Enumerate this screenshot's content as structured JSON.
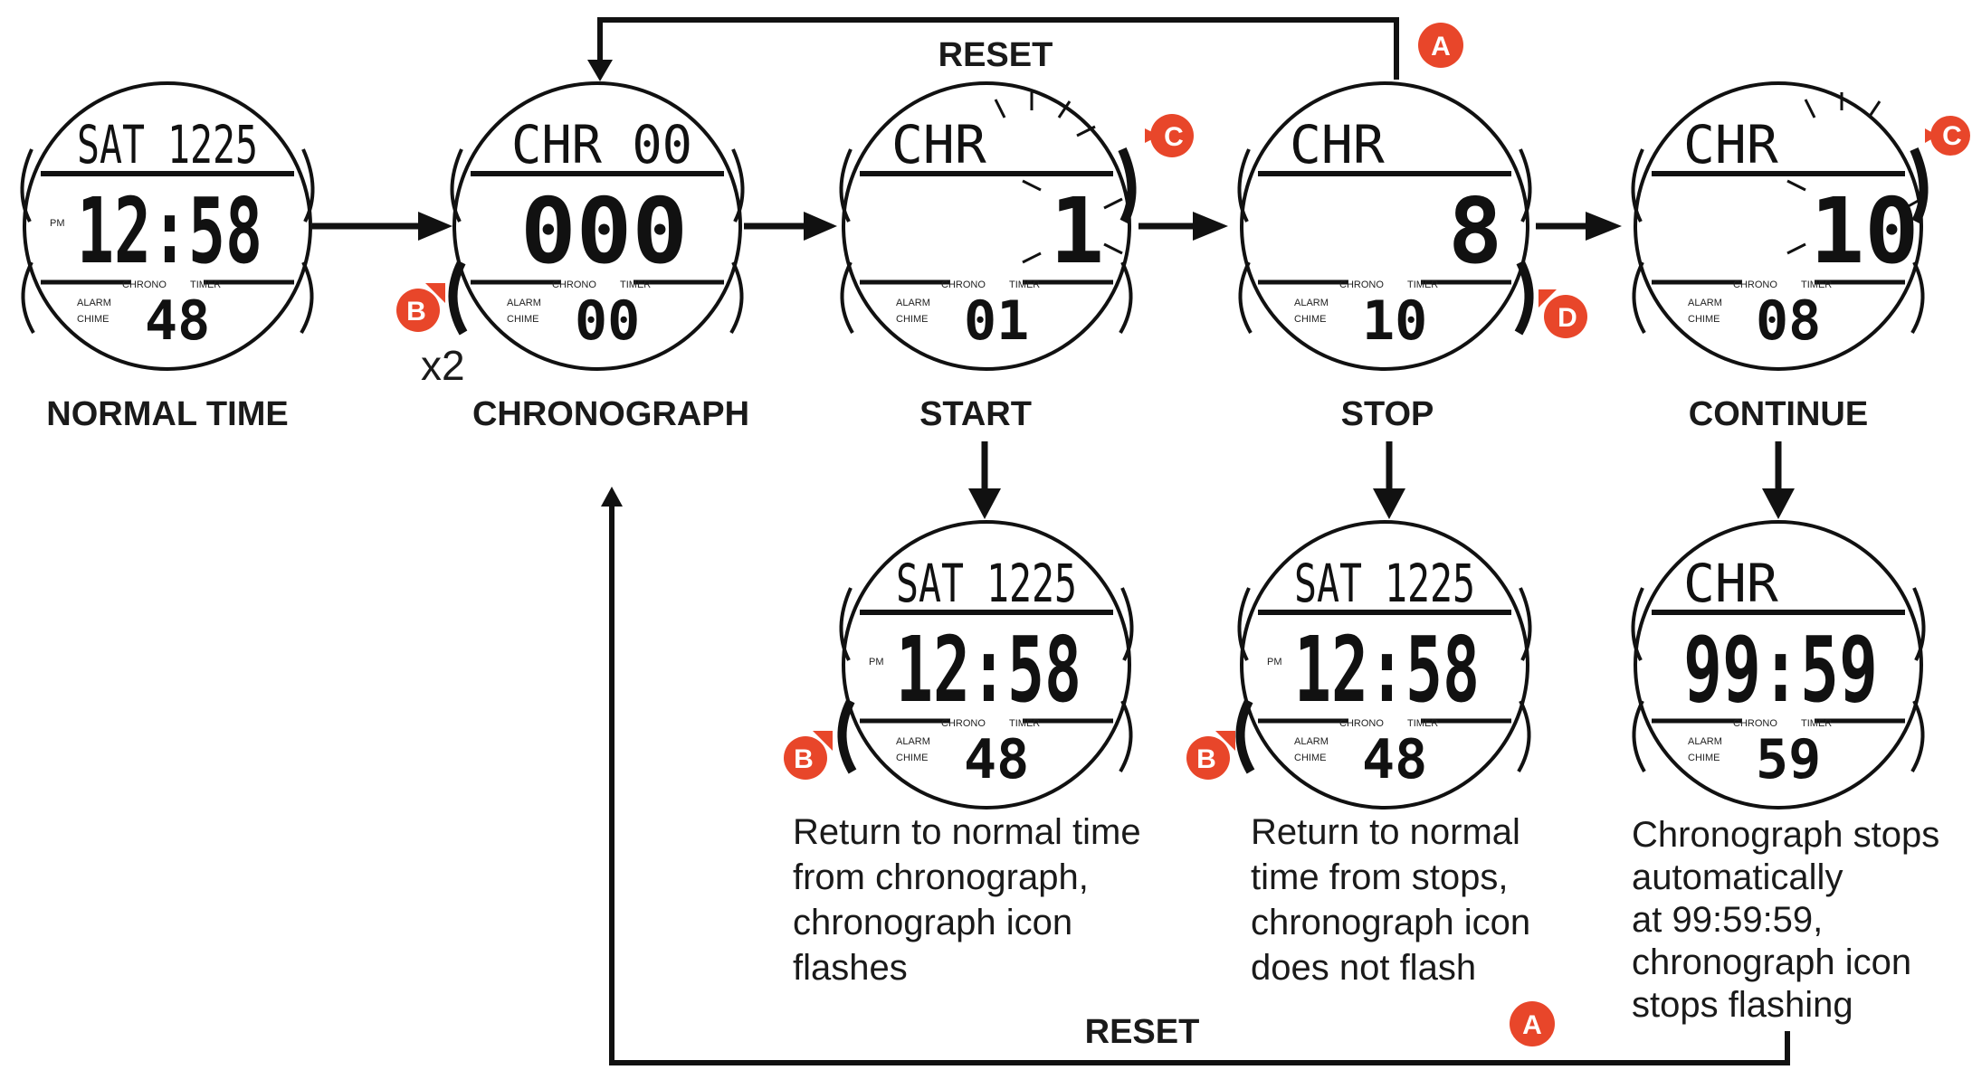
{
  "stages": {
    "normal_time": "NORMAL TIME",
    "chronograph": "CHRONOGRAPH",
    "start": "START",
    "stop": "STOP",
    "continue": "CONTINUE"
  },
  "reset_top": "RESET",
  "reset_bottom": "RESET",
  "press_count": "x2",
  "buttons": {
    "a": "A",
    "b": "B",
    "c": "C",
    "d": "D"
  },
  "watches": {
    "normal": {
      "top": "SAT 1225",
      "main": "12:58",
      "sub": "48",
      "pm": "PM"
    },
    "chrono": {
      "top": "CHR 00",
      "main": "000",
      "sub": "00"
    },
    "start": {
      "top": "CHR",
      "main": "1",
      "sub": "01"
    },
    "stop": {
      "top": "CHR",
      "main": "8",
      "sub": "10"
    },
    "cont": {
      "top": "CHR",
      "main": "10",
      "sub": "08"
    },
    "start_return": {
      "top": "SAT 1225",
      "main": "12:58",
      "sub": "48",
      "pm": "PM"
    },
    "stop_return": {
      "top": "SAT 1225",
      "main": "12:58",
      "sub": "48",
      "pm": "PM"
    },
    "cont_end": {
      "top": "CHR",
      "main": "99:59",
      "sub": "59"
    }
  },
  "lcd_labels": {
    "chrono": "CHRONO",
    "timer": "TIMER",
    "alarm": "ALARM",
    "chime": "CHIME"
  },
  "descriptions": {
    "start": [
      "Return to normal time",
      "from chronograph,",
      "chronograph icon",
      "flashes"
    ],
    "stop": [
      "Return to normal",
      "time from stops,",
      "chronograph icon",
      "does not flash"
    ],
    "cont": [
      "Chronograph stops",
      "automatically",
      "at 99:59:59,",
      "chronograph icon",
      "stops flashing"
    ]
  },
  "colors": {
    "badge": "#e8462a",
    "ink": "#1a1a1a"
  }
}
